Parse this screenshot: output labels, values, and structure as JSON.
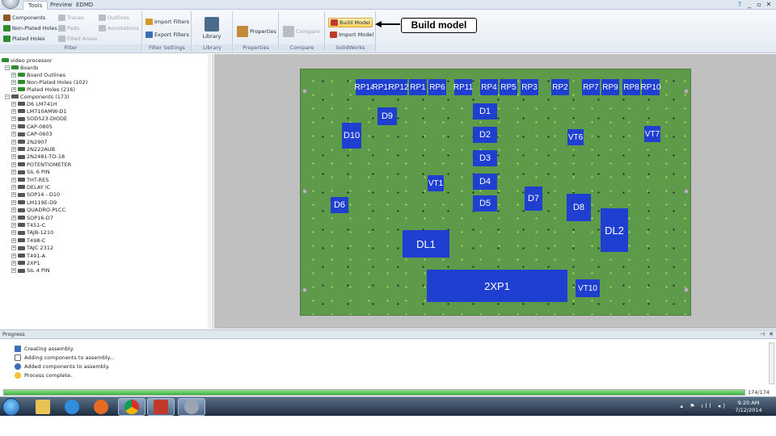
{
  "tabs": {
    "tools": "Tools",
    "preview": "Preview",
    "edmd": "EDMD"
  },
  "window": {
    "help": "?",
    "minimize": "_",
    "restore": "▫",
    "close": "✕"
  },
  "ribbon": {
    "filter": {
      "label": "Filter",
      "components": "Components",
      "non_plated": "Non-Plated Holes",
      "plated": "Plated Holes",
      "traces": "Traces",
      "pads": "Pads",
      "filled_areas": "Filled Areas",
      "outlines": "Outlines",
      "annotations": "Annotations"
    },
    "filter_settings": {
      "label": "Filter Settings",
      "import": "Import Filters",
      "export": "Export Filters"
    },
    "library": {
      "label": "Library",
      "button": "Library"
    },
    "properties": {
      "label": "Properties",
      "button": "Properties"
    },
    "compare": {
      "label": "Compare",
      "button": "Compare"
    },
    "solidworks": {
      "label": "SolidWorks",
      "build": "Build Model",
      "import": "Import Model"
    }
  },
  "callout": "Build model",
  "tree": {
    "root": "video processor",
    "boards": "Boards",
    "board_items": [
      "Board Outlines",
      "Non-Plated Holes (102)",
      "Plated Holes (216)"
    ],
    "components_label": "Components (173)",
    "components": [
      "D6 LM741H",
      "LM710AMW-D1",
      "SOD523-DIODE",
      "CAP-0805",
      "CAP-0603",
      "2N2907",
      "2N222AUB",
      "2N2481-TO-18",
      "POTENTIOMETER",
      "SIL 6 PIN",
      "THT-RES",
      "DELAY IC",
      "SOP14 - D10",
      "LM119E-D9",
      "QUADRO-PLCC",
      "SOP16-D7",
      "T451-C",
      "TAJB-1210",
      "T498-C",
      "TAJC 2312",
      "T491-A",
      "2XP1",
      "SIL 4 PIN"
    ]
  },
  "board": {
    "rp_row": [
      "RP14",
      "RP13",
      "RP12",
      "RP1",
      "RP6",
      "RP11",
      "RP4",
      "RP5",
      "RP3",
      "RP2",
      "RP7",
      "RP9",
      "RP8",
      "RP10"
    ],
    "labels": {
      "d1": "D1",
      "d2": "D2",
      "d3": "D3",
      "d4": "D4",
      "d5": "D5",
      "d6": "D6",
      "d7": "D7",
      "d8": "D8",
      "d9": "D9",
      "d10": "D10",
      "dl1": "DL1",
      "dl2": "DL2",
      "vt1": "VT1",
      "vt6": "VT6",
      "vt7": "VT7",
      "vt10": "VT10",
      "xp1": "2XP1"
    }
  },
  "progress": {
    "title": "Progress",
    "pin": "⊣",
    "close": "✕",
    "messages": [
      "Creating assembly.",
      "Adding components to assembly...",
      "Added components to assembly.",
      "Process complete."
    ],
    "count": "174/174",
    "fraction": 1.0
  },
  "taskbar": {
    "time": "9:20 AM",
    "date": "7/12/2014",
    "tray": "▴ ⚑ ıll ◂)"
  },
  "colors": {
    "board": "#5d9b4b",
    "component": "#1e3fd0",
    "progress": "#3bb33b"
  }
}
